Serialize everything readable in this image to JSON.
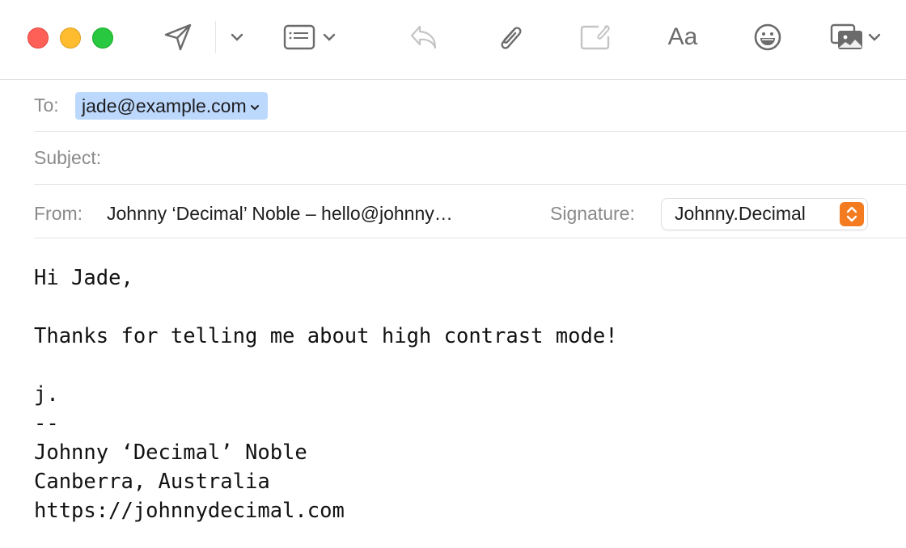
{
  "window": {
    "traffic_lights": [
      {
        "name": "close",
        "color": "#fe5f57"
      },
      {
        "name": "minimize",
        "color": "#febc2e"
      },
      {
        "name": "zoom",
        "color": "#28c840"
      }
    ]
  },
  "toolbar": {
    "buttons": [
      {
        "name": "send",
        "icon": "paper-plane-icon"
      },
      {
        "name": "send-options",
        "icon": "chevron-down-icon"
      },
      {
        "name": "header-fields",
        "icon": "header-list-icon"
      },
      {
        "name": "reply",
        "icon": "reply-arrow-icon",
        "disabled": true
      },
      {
        "name": "attach",
        "icon": "paperclip-icon"
      },
      {
        "name": "include-attachment",
        "icon": "attachment-box-icon",
        "disabled": true
      },
      {
        "name": "format",
        "label": "Aa"
      },
      {
        "name": "emoji",
        "icon": "smiley-icon"
      },
      {
        "name": "photo-browser",
        "icon": "photos-icon"
      }
    ],
    "format_label": "Aa"
  },
  "header": {
    "to_label": "To:",
    "to_value": "jade@example.com",
    "subject_label": "Subject:",
    "subject_value": "",
    "from_label": "From:",
    "from_value": "Johnny ‘Decimal’ Noble – hello@johnny…",
    "signature_label": "Signature:",
    "signature_value": "Johnny.Decimal",
    "accent_color": "#f47b20",
    "chip_color": "#bcd8fd"
  },
  "body": {
    "lines": [
      "Hi Jade,",
      "",
      "Thanks for telling me about high contrast mode!",
      "",
      "j.",
      "--",
      "Johnny ‘Decimal’ Noble",
      "Canberra, Australia",
      "https://johnnydecimal.com"
    ],
    "text": "Hi Jade,\n\nThanks for telling me about high contrast mode!\n\nj.\n--\nJohnny ‘Decimal’ Noble\nCanberra, Australia\nhttps://johnnydecimal.com"
  }
}
